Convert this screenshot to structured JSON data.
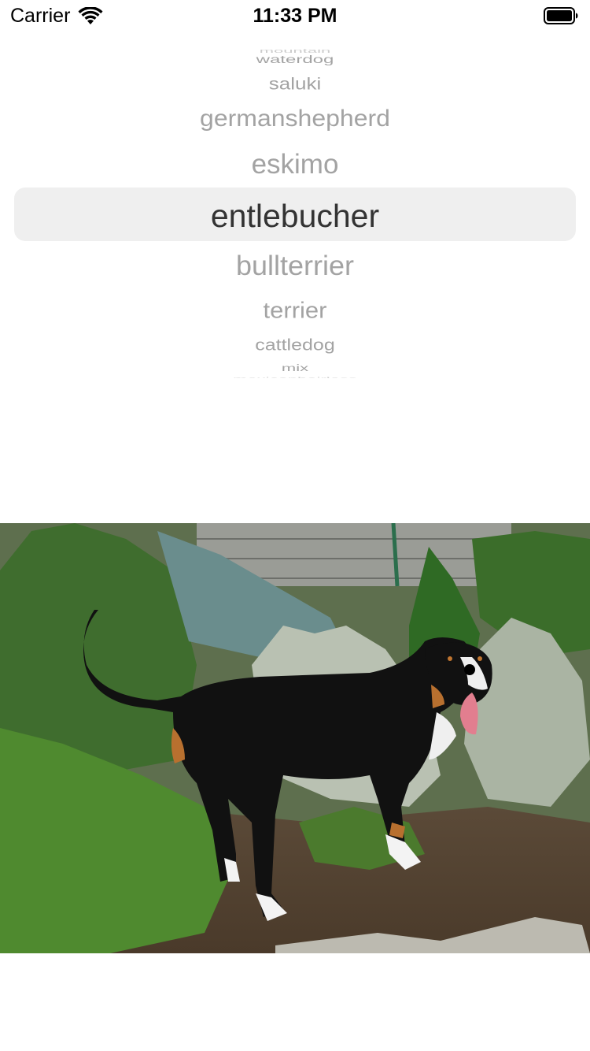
{
  "status_bar": {
    "carrier": "Carrier",
    "time": "11:33 PM",
    "icons": [
      "wifi-icon",
      "battery-icon"
    ]
  },
  "picker": {
    "items": [
      "mountain",
      "waterdog",
      "saluki",
      "germanshepherd",
      "eskimo",
      "entlebucher",
      "bullterrier",
      "terrier",
      "cattledog",
      "mix",
      "mexicanhairless"
    ],
    "selected": "entlebucher"
  },
  "photo": {
    "subject": "entlebucher dog standing in a garden"
  },
  "colors": {
    "picker_text": "#a3a3a3",
    "picker_selected_text": "#333333",
    "picker_highlight": "#efefef"
  }
}
